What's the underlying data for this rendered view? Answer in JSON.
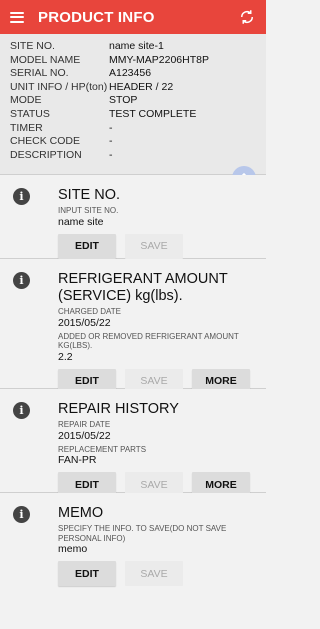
{
  "header": {
    "title": "PRODUCT INFO",
    "menu_icon": "hamburger-menu-icon",
    "refresh_icon": "refresh-icon",
    "accent_color": "#e8453c"
  },
  "info": {
    "rows": [
      {
        "label": "SITE NO.",
        "value": "name site-1"
      },
      {
        "label": "MODEL NAME",
        "value": "MMY-MAP2206HT8P"
      },
      {
        "label": "SERIAL NO.",
        "value": "A123456"
      },
      {
        "label": "UNIT INFO / HP(ton)",
        "value": "HEADER / 22"
      },
      {
        "label": "MODE",
        "value": "STOP"
      },
      {
        "label": "STATUS",
        "value": "TEST COMPLETE"
      },
      {
        "label": "TIMER",
        "value": "-"
      },
      {
        "label": "CHECK CODE",
        "value": "-"
      },
      {
        "label": "DESCRIPTION",
        "value": "-"
      }
    ]
  },
  "sections": {
    "site": {
      "title": "SITE NO.",
      "input_label": "INPUT SITE NO.",
      "value": "name site",
      "edit_label": "EDIT",
      "save_label": "SAVE"
    },
    "refrigerant": {
      "title": "REFRIGERANT AMOUNT (SERVICE) kg(lbs).",
      "date_label": "CHARGED DATE",
      "date_value": "2015/05/22",
      "amount_label": "ADDED OR REMOVED REFRIGERANT AMOUNT kg(lbs).",
      "amount_value": "2.2",
      "edit_label": "EDIT",
      "save_label": "SAVE",
      "more_label": "MORE"
    },
    "repair": {
      "title": "REPAIR HISTORY",
      "date_label": "REPAIR DATE",
      "date_value": "2015/05/22",
      "parts_label": "REPLACEMENT PARTS",
      "parts_value": "FAN-PR",
      "edit_label": "EDIT",
      "save_label": "SAVE",
      "more_label": "MORE"
    },
    "memo": {
      "title": "MEMO",
      "hint": "SPECIFY THE INFO. TO SAVE(DO NOT SAVE PERSONAL INFO)",
      "value": "memo",
      "edit_label": "EDIT",
      "save_label": "SAVE"
    }
  }
}
